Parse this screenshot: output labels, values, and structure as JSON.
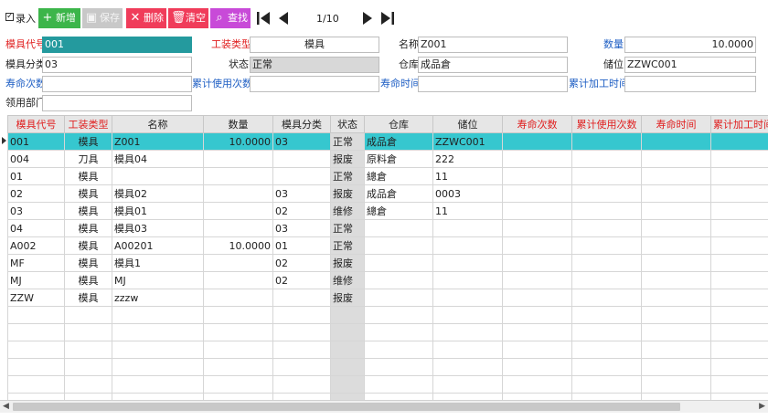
{
  "toolbar": {
    "entry_label": "录入",
    "new_label": "新增",
    "save_label": "保存",
    "delete_label": "删除",
    "clear_label": "清空",
    "search_label": "查找",
    "pager": "1/10",
    "colors": {
      "new": "#3cb54a",
      "save": "#c8c8c8",
      "delete": "#f03c5a",
      "clear": "#f03c5a",
      "search": "#c84ad8"
    },
    "icons": {
      "new": "plus-icon",
      "save": "floppy-icon",
      "delete": "x-icon",
      "clear": "trash-icon",
      "search": "magnifier-icon"
    }
  },
  "form": {
    "mold_code_label": "模具代号",
    "mold_code": "001",
    "tool_type_label": "工装类型",
    "tool_type": "模具",
    "name_label": "名称",
    "name": "Z001",
    "qty_label": "数量",
    "qty": "10.0000",
    "category_label": "模具分类",
    "category": "03",
    "status_label": "状态",
    "status": "正常",
    "warehouse_label": "仓库",
    "warehouse": "成品倉",
    "location_label": "储位",
    "location": "ZZWC001",
    "life_count_label": "寿命次数",
    "life_count": "",
    "cum_usage_label": "累计使用次数",
    "cum_usage": "",
    "life_time_label": "寿命时间",
    "life_time": "",
    "cum_proc_label": "累计加工时间",
    "cum_proc": "",
    "dept_label": "领用部门",
    "dept": ""
  },
  "left_grid": {
    "headers": [
      "模具代号",
      "工装类型",
      "名称",
      "数量",
      "模具分类",
      "状态"
    ],
    "rows": [
      [
        "001",
        "模具",
        "Z001",
        "10.0000",
        "03",
        "正常"
      ],
      [
        "004",
        "刀具",
        "模具04",
        "",
        "",
        "报废"
      ],
      [
        "01",
        "模具",
        "",
        "",
        "",
        "正常"
      ],
      [
        "02",
        "模具",
        "模具02",
        "",
        "03",
        "报废"
      ],
      [
        "03",
        "模具",
        "模具01",
        "",
        "02",
        "维修"
      ],
      [
        "04",
        "模具",
        "模具03",
        "",
        "03",
        "正常"
      ],
      [
        "A002",
        "模具",
        "A00201",
        "10.0000",
        "01",
        "正常"
      ],
      [
        "MF",
        "模具",
        "模具1",
        "",
        "02",
        "报废"
      ],
      [
        "MJ",
        "模具",
        "MJ",
        "",
        "02",
        "维修"
      ],
      [
        "ZZW",
        "模具",
        "zzzw",
        "",
        "",
        "报废"
      ]
    ]
  },
  "right_grid": {
    "headers": [
      "仓库",
      "储位",
      "寿命次数",
      "累计使用次数",
      "寿命时间",
      "累计加工时间"
    ],
    "rows": [
      [
        "成品倉",
        "ZZWC001",
        "",
        "",
        "",
        ""
      ],
      [
        "原料倉",
        "222",
        "",
        "",
        "",
        ""
      ],
      [
        "總倉",
        "11",
        "",
        "",
        "",
        ""
      ],
      [
        "成品倉",
        "0003",
        "",
        "",
        "",
        ""
      ],
      [
        "總倉",
        "11",
        "",
        "",
        "",
        ""
      ]
    ]
  },
  "selection_color": "#36c7cf"
}
